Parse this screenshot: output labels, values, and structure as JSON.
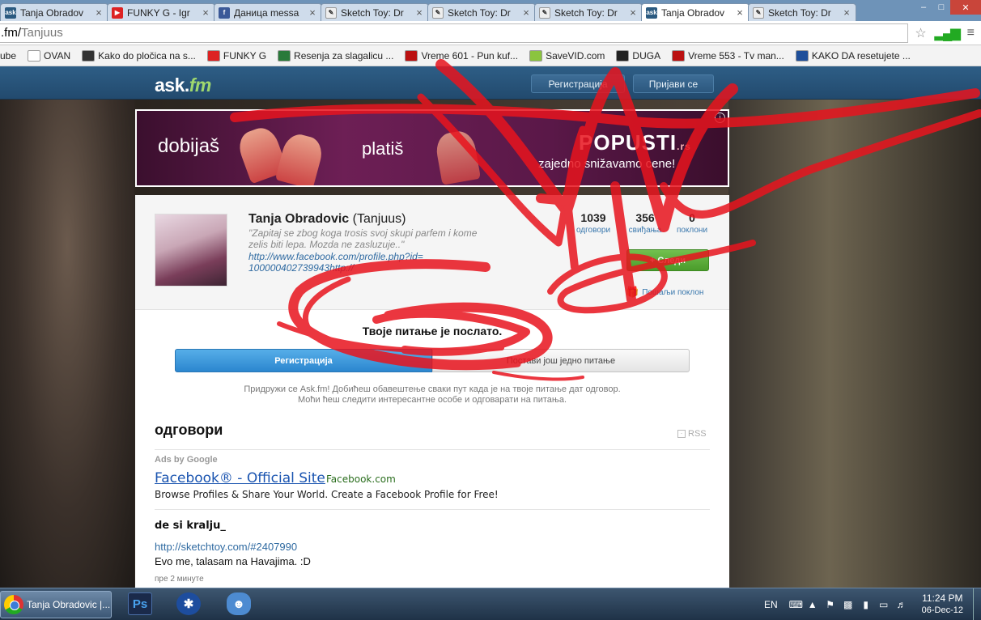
{
  "browser": {
    "tabs": [
      {
        "label": "Tanja Obradov",
        "icon": "ask-icon",
        "active": false
      },
      {
        "label": "FUNKY G - Igr",
        "icon": "youtube-icon",
        "active": false
      },
      {
        "label": "Даница messa",
        "icon": "facebook-icon",
        "active": false
      },
      {
        "label": "Sketch Toy: Dr",
        "icon": "sketch-icon",
        "active": false
      },
      {
        "label": "Sketch Toy: Dr",
        "icon": "sketch-icon",
        "active": false
      },
      {
        "label": "Sketch Toy: Dr",
        "icon": "sketch-icon",
        "active": false
      },
      {
        "label": "Tanja Obradov",
        "icon": "ask-icon",
        "active": true
      },
      {
        "label": "Sketch Toy: Dr",
        "icon": "sketch-icon",
        "active": false
      }
    ],
    "url_host": ".fm/",
    "url_path": "Tanjuus",
    "bookmarks": [
      {
        "label": "ube",
        "color": ""
      },
      {
        "label": "OVAN",
        "color": "#ffffff"
      },
      {
        "label": "Kako do pločica na s...",
        "color": "#333333"
      },
      {
        "label": "FUNKY G",
        "color": "#dd2222"
      },
      {
        "label": "Resenja za slagalicu ...",
        "color": "#2a7a3a"
      },
      {
        "label": "Vreme 601 - Pun kuf...",
        "color": "#bb1111"
      },
      {
        "label": "SaveVID.com",
        "color": "#8bc43f"
      },
      {
        "label": "DUGA",
        "color": "#222222"
      },
      {
        "label": "Vreme 553 - Tv man...",
        "color": "#bb1111"
      },
      {
        "label": "KAKO DA resetujete ...",
        "color": "#1f4f9a"
      }
    ]
  },
  "site": {
    "logo_main": "ask.",
    "logo_fm": "fm",
    "register_label": "Регистрација",
    "login_label": "Пријави се"
  },
  "banner": {
    "word1": "dobijaš",
    "word2": "platiš",
    "brand": "POPUSTI",
    "brand_tld": ".rs",
    "tagline": "zajedno snižavamo cene!",
    "info": "i"
  },
  "profile": {
    "name": "Tanja Obradovic",
    "username": "(Tanjuus)",
    "quote": "\"Zapitaj se zbog koga trosis svoj skupi parfem i kome zelis biti lepa. Mozda ne zasluzuje..\"",
    "link": "http://www.facebook.com/profile.php?id=100000402739943http://",
    "stats": [
      {
        "value": "1039",
        "label": "одговори"
      },
      {
        "value": "356",
        "label": "свиђања"
      },
      {
        "value": "0",
        "label": "поклони"
      }
    ],
    "follow_label": "+ Следи",
    "gift_label": "Пошаљи поклон"
  },
  "question_sent": {
    "message": "Твоје питање је послато.",
    "register_button": "Регистрација",
    "ask_again_button": "Постави још једно питање",
    "join_line1": "Придружи се Ask.fm! Добићеш обавештење сваки пут када је на твоје питање дат одговор.",
    "join_line2": "Моћи ћеш следити интересантне особе и одговарати на питања."
  },
  "answers": {
    "heading": "одговори",
    "rss": "RSS",
    "ad": {
      "ads_by": "Ads by Google",
      "title": "Facebook® - Official Site",
      "domain": "Facebook.com",
      "description": "Browse Profiles & Share Your World. Create a Facebook Profile for Free!"
    },
    "items": [
      {
        "question": "de si kralju_",
        "link": "http://sketchtoy.com/#2407990",
        "text": "Evo me, talasam na Havajima. :D",
        "time": "пре 2 минуте"
      }
    ]
  },
  "taskbar": {
    "active_task": "Tanja Obradovic |...",
    "language": "EN",
    "time": "11:24 PM",
    "date": "06-Dec-12"
  },
  "colors": {
    "ask_blue": "#224a6e",
    "ask_green": "#9fd86e",
    "scribble_red": "#e8141e"
  }
}
